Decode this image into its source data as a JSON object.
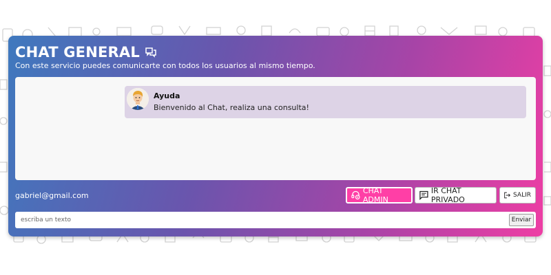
{
  "header": {
    "title": "CHAT GENERAL",
    "title_icon": "chat-bubbles-icon",
    "subtitle": "Con este servicio puedes comunicarte con todos los usuarios al mismo tiempo."
  },
  "messages": [
    {
      "author": "Ayuda",
      "text": "Bienvenido al Chat, realiza una consulta!",
      "avatar": "blonde-man-avatar"
    }
  ],
  "user": {
    "email": "gabriel@gmail.com"
  },
  "actions": {
    "admin_label": "CHAT ADMIN",
    "admin_icon": "headset-icon",
    "private_label": "IR CHAT PRIVADO",
    "private_icon": "message-icon",
    "exit_label": "SALIR",
    "exit_icon": "logout-icon"
  },
  "composer": {
    "placeholder": "escriba un texto",
    "value": "",
    "send_label": "Enviar"
  },
  "colors": {
    "gradient_start": "#3f79be",
    "gradient_mid": "#6a55ad",
    "gradient_end": "#ee3ea4",
    "admin_button": "#ff3fa6",
    "message_bubble": "#ddd3e6"
  }
}
